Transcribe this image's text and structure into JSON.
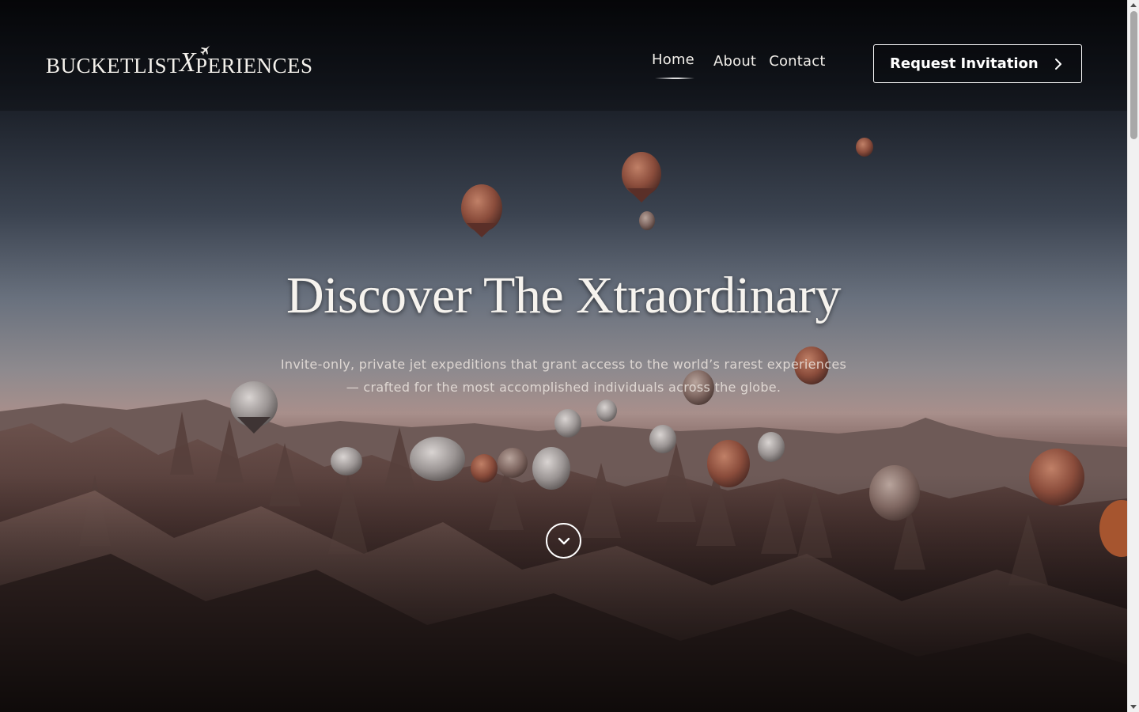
{
  "brand": {
    "logo_text_before": "BUCKETLIST",
    "logo_x": "X",
    "logo_text_after": "PERIENCES",
    "logo_icon": "airplane-icon"
  },
  "nav": {
    "items": [
      {
        "label": "Home",
        "active": true
      },
      {
        "label": "About",
        "active": false
      },
      {
        "label": "Contact",
        "active": false
      }
    ]
  },
  "cta": {
    "label": "Request Invitation",
    "icon": "chevron-right-icon"
  },
  "hero": {
    "headline": "Discover The Xtraordinary",
    "subtitle_line1": "Invite-only, private jet expeditions that grant access to the world’s rarest experiences",
    "subtitle_line2": "— crafted for the most accomplished individuals across the globe.",
    "scroll_icon": "chevron-down-icon"
  },
  "colors": {
    "sky_top": "#0a0c10",
    "sky_mid": "#5c6778",
    "horizon": "#b59a92",
    "terrain": "#4a3431",
    "text": "#f6f3ee"
  }
}
